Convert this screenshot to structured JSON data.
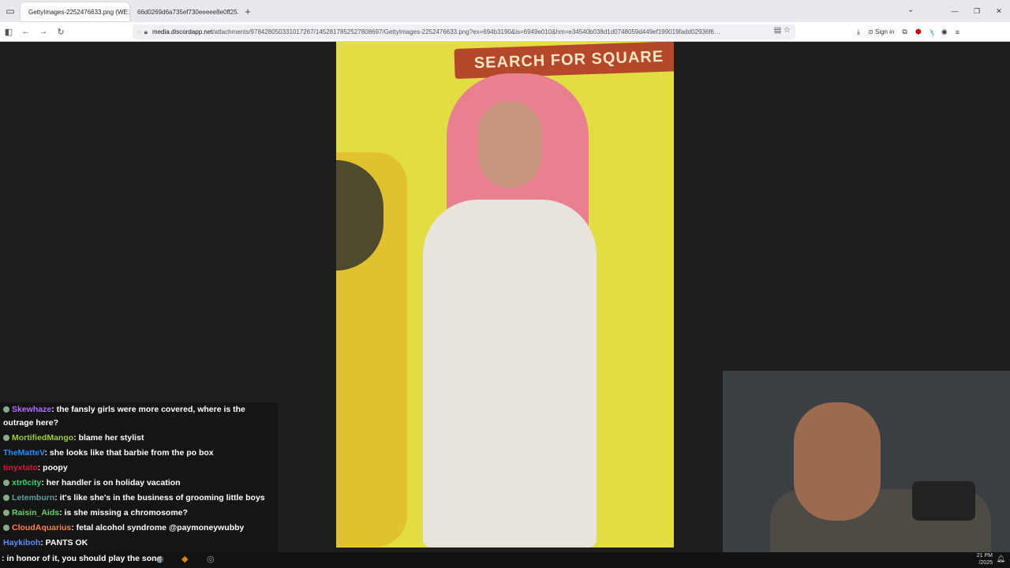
{
  "browser": {
    "tabs": [
      {
        "label": "GettyImages-2252476633.png (WE…",
        "active": true
      },
      {
        "label": "66d0269d6a735ef730eeeee8e0ff25…",
        "active": false
      }
    ],
    "url_prefix": "",
    "url_host": "media.discordapp.net",
    "url_path": "/attachments/978428050331017267/1452817852527808697/GettyImages-2252476633.png?ex=694b3190&is=6949e010&hm=e34540b038d1d0748059d449ef199019fadd02936f6…",
    "signin_label": "Sign in"
  },
  "photo": {
    "banner_text": "SEARCH FOR SQUARE"
  },
  "chat": [
    {
      "user": "Skewhaze",
      "color": "#b56cff",
      "text": ": the fansly girls were more covered, where is the outrage here?",
      "badge": true
    },
    {
      "user": "MortifiedMango",
      "color": "#9acd32",
      "text": ": blame her stylist",
      "badge": true
    },
    {
      "user": "TheMatteV",
      "color": "#1e90ff",
      "text": ": she looks like that barbie from the po box",
      "badge": false
    },
    {
      "user": "tinyxtato",
      "color": "#dc143c",
      "text": ": poopy",
      "badge": false
    },
    {
      "user": "xtr0city",
      "color": "#2fd66d",
      "text": ": her handler is on holiday vacation",
      "badge": true
    },
    {
      "user": "Letemburn",
      "color": "#5f9ea0",
      "text": ": it's like she's in the business of grooming little boys",
      "badge": true
    },
    {
      "user": "Raisin_Aids",
      "color": "#66d466",
      "text": ": is she missing a chromosome?",
      "badge": true
    },
    {
      "user": "CloudAquarius",
      "color": "#ff7f50",
      "text": ": fetal alcohol syndrome @paymoneywubby",
      "badge": true
    },
    {
      "user": "Haykiboh",
      "color": "#5b8cff",
      "text": ": PANTS OK",
      "badge": false
    }
  ],
  "taskbar": {
    "partial_message": ": in honor of it, you should play the song",
    "time": "21 PM",
    "date": "/2025"
  }
}
